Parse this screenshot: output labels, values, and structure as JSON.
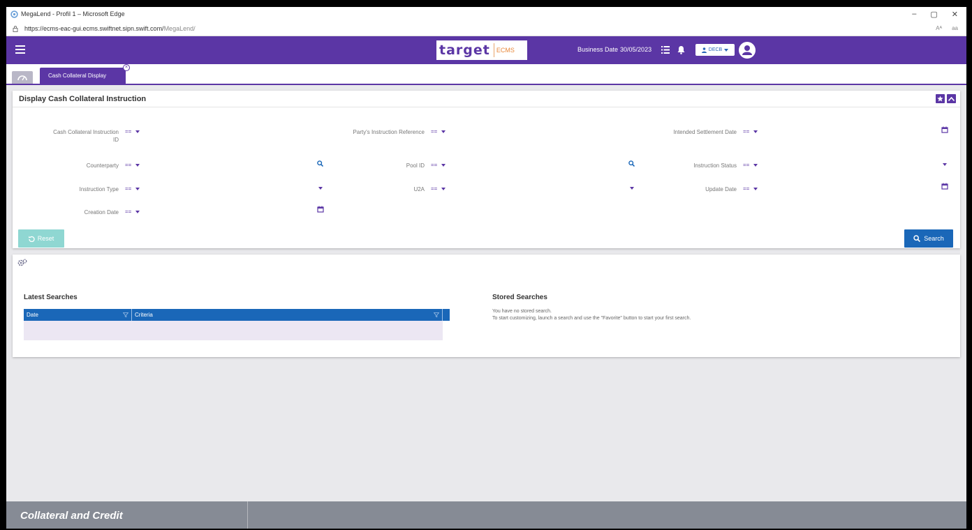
{
  "browser": {
    "title": "MegaLend - Profil 1 – Microsoft Edge",
    "url_main": "https://ecms-eac-gui.ecms.swiftnet.sipn.swift.com/",
    "url_path": "MegaLend/",
    "controls": [
      "–",
      "▢",
      "✕"
    ],
    "tools": [
      "Aᴬ",
      "aa"
    ]
  },
  "header": {
    "logo_text": "target",
    "logo_sub": "ECMS",
    "business_date_label": "Business Date",
    "business_date_value": "30/05/2023",
    "user_label": "DECB"
  },
  "tabs": {
    "active_label": "Cash Collateral Display"
  },
  "form": {
    "title": "Display Cash Collateral Instruction",
    "operator": "==",
    "fields": {
      "cash_collateral_id_1": "Cash Collateral Instruction",
      "cash_collateral_id_2": "ID",
      "party_ref": "Party's Instruction Reference",
      "intended_date": "Intended Settlement Date",
      "counterparty": "Counterparty",
      "pool_id": "Pool ID",
      "instruction_status": "Instruction Status",
      "instruction_type": "Instruction Type",
      "u2a": "U2A",
      "update_date": "Update Date",
      "creation_date": "Creation Date"
    },
    "reset_label": "Reset",
    "search_label": "Search"
  },
  "searches": {
    "latest_title": "Latest Searches",
    "col_date": "Date",
    "col_criteria": "Criteria",
    "stored_title": "Stored Searches",
    "stored_line1": "You have no stored search.",
    "stored_line2": "To start customizing, launch a search and use the \"Favorite\" button to start your first search."
  },
  "footer": {
    "text": "Collateral and Credit"
  },
  "colors": {
    "brand": "#5b36a5",
    "primary": "#1a67b8",
    "reset": "#8fd7d2"
  }
}
